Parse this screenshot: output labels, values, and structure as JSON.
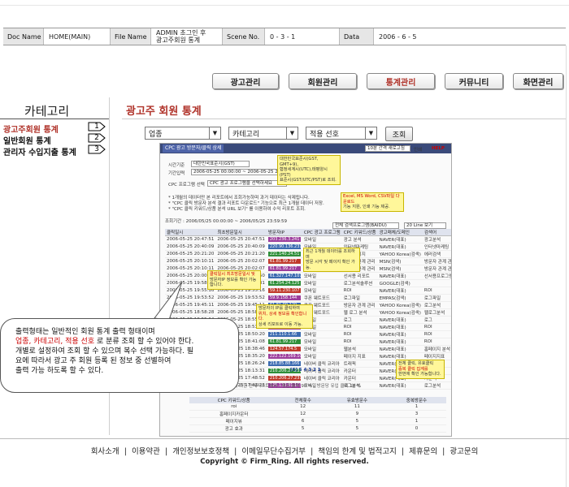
{
  "doc_header": {
    "doc_name_label": "Doc Name",
    "doc_name_value": "HOME(MAIN)",
    "file_name_label": "File Name",
    "file_name_value_1": "ADMIN 초그인 후",
    "file_name_value_2": "광고주회원 통계",
    "scene_label": "Scene No.",
    "scene_value": "0 - 3 - 1",
    "data_label": "Data",
    "data_value": "2006 - 6 - 5"
  },
  "nav": [
    "광고관리",
    "회원관리",
    "통계관리",
    "커뮤니티",
    "화면관리"
  ],
  "sidebar": {
    "title": "카테고리",
    "items": [
      {
        "label": "광고주회원 통계",
        "num": "1"
      },
      {
        "label": "일반회원 통계",
        "num": "2"
      },
      {
        "label": "관리자 수입지출 통계",
        "num": "3"
      }
    ]
  },
  "main": {
    "title": "광고주 회원 통계",
    "select1": "업종",
    "select2": "카테고리",
    "select3": "적용 선호",
    "search": "조회"
  },
  "shot": {
    "tab1": "CPC 광고 방문자/클릭 상세",
    "tab2": "",
    "range_select": "10분 간격 새로고침",
    "print": "인쇄",
    "help": "HELP",
    "time_label": "시간기준",
    "time_value": "대한민국표준시(GST)",
    "period_label": "기간입력",
    "period_value": "2006-05-25 00:00:00 ~ 2006-05-25 23:59:59",
    "cpc_label": "CPC 프로그램 선택",
    "cpc_value": "CPC 광고 프로그램을 선택하세요",
    "info1": "* 1개월의 데이터만 본 리포트에서 조회가능하며 과거 데이터는 삭제됩니다.",
    "info2": "* \"CPC 클릭 방문자 분석 결과 리포트 다운로드\" 기능으로 최근 1개월 데이터 저장.",
    "info3": "* \"CPC 클릭 키워드/상품 분석 URL 보기\" 를 이용하여 수익 리포트 조회.",
    "query_period": "조회기간 : 2006/05/25 00:00:00 ~ 2006/05/25 23:59:59",
    "filter1": "전체 검색프로그램(BAIDU)",
    "filter2": "20 Line 보기",
    "columns": [
      "클릭일시",
      "최초방문일시",
      "방문자IP",
      "CPC 광고 프로그램",
      "CPC 키워드/상품",
      "광고매체/도메인",
      "검색어"
    ],
    "rows": [
      [
        "2006-05-25 20:47:51",
        "2006-05-25 20:47:51",
        "203.236.3.241",
        "모바일",
        "광고 분석",
        "NAVER(대표)",
        "광고분석"
      ],
      [
        "2006-05-25 20:40:09",
        "2006-05-25 20:40:09",
        "220.90.136.231",
        "모바일",
        "인터넷마케팅",
        "NAVER(대표)",
        "인터넷마케팅"
      ],
      [
        "2006-05-25 20:21:20",
        "2006-05-25 20:21:20",
        "221.140.24.51",
        "모바일",
        "오류 페이지",
        "YAHOO Korea(검색)",
        "에러검색"
      ],
      [
        "2006-05-25 20:10:11",
        "2006-05-25 20:02:07",
        "61.81.99.217",
        "모바일",
        "방문자 관계 관리",
        "MSN(검색)",
        "방문자 관계 관리"
      ],
      [
        "2006-05-25 20:10:11",
        "2006-05-25 20:02:07",
        "61.81.99.217",
        "모바일",
        "방문자 관계 관리",
        "MSN(검색)",
        "방문자 관계 관리"
      ],
      [
        "2006-05-25 20:00:50",
        "2006-05-25 20:00:50",
        "61.327.147.107",
        "모바일",
        "선서용 리포트",
        "NAVER(대표)",
        "선서용프로그램"
      ],
      [
        "2006-05-25 19:58:31",
        "2006-05-25 19:58:31",
        "61.254.24.125",
        "모바일",
        "로그분석솔루션",
        "GOOGLE(검색)",
        ""
      ],
      [
        "2006-05-25 19:55:16",
        "2006-05-25 19:55:16",
        "59.11.230.107",
        "모바일",
        "ROI",
        "NAVER(대표)",
        "ROI"
      ],
      [
        "2006-05-25 19:53:52",
        "2006-05-25 19:53:52",
        "59.9.158.144",
        "쿠폰 웨트포드",
        "로그파일",
        "EMPAS(검색)",
        "로그파일"
      ],
      [
        "2006-05-25 19:45:11",
        "2006-05-25 19:45:11",
        "61.81.99.129",
        "쿠폰 웨트포드",
        "방문자 관계 관리",
        "YAHOO Korea(검색)",
        "로그분석"
      ],
      [
        "2006-05-25 18:58:28",
        "2006-05-25 18:58:28",
        "61.81.99.218",
        "쿠폰 웨트포드",
        "웹 로그 분석",
        "YAHOO Korea(검색)",
        "웹로그분석"
      ],
      [
        "2006-05-25 18:55:04",
        "2006-05-25 18:55:04",
        "211.33.152.85",
        "모바일",
        "로그",
        "NAVER(대표)",
        "로그"
      ],
      [
        "2006-05-25 18:53:33",
        "2006-05-25 18:53:33",
        "59.12.201.145",
        "모바일",
        "ROI",
        "NAVER(대표)",
        "ROI"
      ],
      [
        "2006-05-25 18:50:20",
        "2006-05-25 18:50:20",
        "211.110.1.66",
        "모바일",
        "ROI",
        "NAVER(대표)",
        "ROI"
      ],
      [
        "2006-05-25 18:41:08",
        "2006-05-25 18:41:08",
        "61.81.99.217",
        "모바일",
        "ROI",
        "NAVER(대표)",
        "ROI"
      ],
      [
        "2006-05-25 18:38:46",
        "2006-05-25 18:38:46",
        "124.57.174.5",
        "모바일",
        "웹분석",
        "NAVER(대표)",
        "홈페이지 분석"
      ],
      [
        "2006-05-25 18:35:20",
        "2006-05-25 18:35:20",
        "222.122.169.103",
        "모바일",
        "페이지 지표",
        "NAVER(대표)",
        "페이지지표"
      ],
      [
        "2006-05-25 18:26:24",
        "2006-05-25 18:26:24",
        "218.85.88.166",
        "네이버 클릭 코리아",
        "트래픽",
        "NAVER(대표)",
        "트래픽"
      ],
      [
        "2006-05-25 18:13:31",
        "2006-05-25 18:13:31",
        "210.206.27.231",
        "네이버 클릭 코리아",
        "카운터",
        "NAVER(대표)",
        "카운터"
      ],
      [
        "2006-05-25 17:48:52",
        "2006-05-25 17:48:52",
        "210.206.27.231",
        "네이버 클릭 코리아",
        "카운터",
        "NAVER(대표)",
        "카운터"
      ],
      [
        "2006-05-25 17:42:23",
        "2006-05-25 17:42:23",
        "125.133.91.103",
        "모바일",
        "로그분석",
        "NAVER(대표)",
        "로그분석"
      ]
    ],
    "pager": "[6] 5 4 3 2 1",
    "summary": "검색조건에 의한 전체리스트에서 : 평균 클릭 90 % , 방문당 유입 클릭 10 %",
    "sum_columns": [
      "CPC 키워드/상품",
      "전체횟수",
      "유효방문수",
      "중복방문수"
    ],
    "sum_rows": [
      [
        "roi",
        "12",
        "11",
        "1"
      ],
      [
        "홈페이지카운터",
        "12",
        "9",
        "3"
      ],
      [
        "페이지뷰",
        "6",
        "5",
        "1"
      ],
      [
        "광고 효과",
        "5",
        "5",
        "0"
      ]
    ],
    "note1_line1": "대한민국표준시(GST, GMT+9),",
    "note1_line2": "협정세계시(UTC),태평양시(PST)",
    "note1_line3": "표준시(GST/UTC/PST)로 조회.",
    "note2_line1": "Excel, MS Word, CSV파일 다운로드",
    "note2_line2": "기능 지원, 인쇄 기능 제공.",
    "note3_line1": "최근 1개월 데이터를 조회하며",
    "note3_line2": "방문 시각 및 페이지 확인 가능.",
    "note4_line1": "클릭일시 최초방문일시 및",
    "note4_line2": "방문자IP 정보를 확인 가능합니다.",
    "note5_line1": "방문자의 IP를 클릭하여",
    "note5_line2": "위치, 상세 정보를 확인합니다.",
    "note5_line3": "상세 리포트로 이동 가능.",
    "note6_line1": "전체 클릭, 유효클릭",
    "note6_line2": "중복 클릭 집계를",
    "note6_line3": "한번에 확인 가능합니다."
  },
  "bubble": {
    "line1": "출력형태는 일반적인 회원 통계 출력 형태이며",
    "line2_hl": "업종, 카테고리, 적용 선호",
    "line2_rest": "로 분류 조회 할 수 있어야 한다.",
    "line3": "개별로 설정하여 조회 할 수 있으며 복수 선택 가능하다. 필",
    "line4": "요에 따라서 광고 주 회원 등록 된 정보 중 선별하여",
    "line5": "출력 가능 하도록 할 수 있다."
  },
  "footer": {
    "links": [
      "회사소개",
      "이용약관",
      "개인정보보호정책",
      "이메일무단수집거부",
      "책임의 한계 및 법적고지",
      "제휴문의",
      "광고문의"
    ],
    "separator": "|",
    "copyright": "Copyright © Firm_Ring.  All rights reserved."
  },
  "colors": {
    "accent": "#b0332a",
    "note_yellow": "#fff79a",
    "shot_header": "#3a4a7a",
    "ip_palette": [
      "#9c3d9c",
      "#3b6ab0",
      "#2f8f3a",
      "#c03a2b"
    ]
  }
}
